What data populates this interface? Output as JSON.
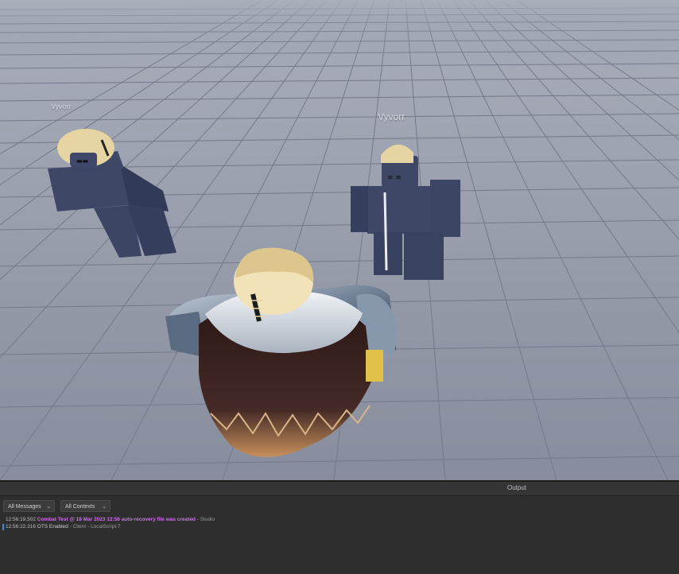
{
  "viewport": {
    "nametags": [
      {
        "id": "left",
        "text": "Vyvorr"
      },
      {
        "id": "right",
        "text": "Vyvorr"
      }
    ],
    "colors": {
      "baseplate": "#8c92a2",
      "grid_line": "#6f7585",
      "character_body": "#3f4868",
      "hair": "#e8d5a0",
      "fur_collar": "#dfe6ec",
      "cape": "#3d2523"
    }
  },
  "output": {
    "title": "Output",
    "filters": {
      "messages": "All Messages",
      "contexts": "All Contexts"
    },
    "logs": [
      {
        "time": "12:56:19.502",
        "message": "Combat Test @ 18 Mar 2023 12:56 auto-recovery file was created",
        "source": "- Studio",
        "style": "warn"
      },
      {
        "time": "12:56:22.316",
        "message": "OTS Enabled",
        "source": "- Client - LocalScript:7",
        "style": "normal"
      }
    ]
  }
}
